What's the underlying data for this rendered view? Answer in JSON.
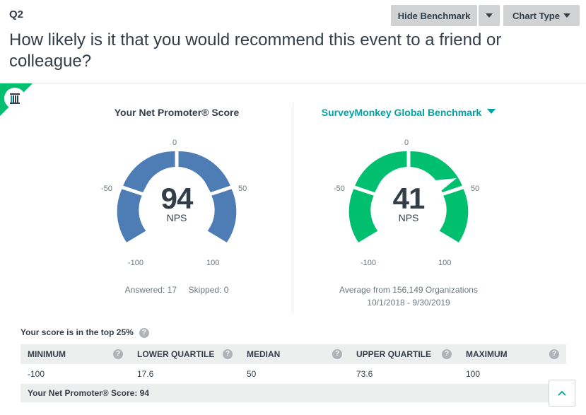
{
  "question": {
    "number": "Q2",
    "text": "How likely is it that you would recommend this event to a friend or colleague?"
  },
  "toolbar": {
    "hide_benchmark": "Hide Benchmark",
    "chart_type": "Chart Type"
  },
  "left_panel": {
    "title": "Your Net Promoter® Score",
    "score": "94",
    "unit": "NPS",
    "ticks": {
      "top": "0",
      "left": "-50",
      "right": "50",
      "bottom_left": "-100",
      "bottom_right": "100"
    },
    "answered": "Answered: 17",
    "skipped": "Skipped: 0",
    "color": "#4e7db5"
  },
  "right_panel": {
    "title": "SurveyMonkey Global Benchmark",
    "score": "41",
    "unit": "NPS",
    "ticks": {
      "top": "0",
      "left": "-50",
      "right": "50",
      "bottom_left": "-100",
      "bottom_right": "100"
    },
    "average": "Average from 156,149 Organizations",
    "date_range": "10/1/2018 - 9/30/2019",
    "color": "#00bf6f"
  },
  "summary": {
    "top_note": "Your score is in the top 25%",
    "headers": [
      "MINIMUM",
      "LOWER QUARTILE",
      "MEDIAN",
      "UPPER QUARTILE",
      "MAXIMUM"
    ],
    "values": [
      "-100",
      "17.6",
      "50",
      "73.6",
      "100"
    ],
    "footer": "Your Net Promoter® Score: 94"
  },
  "icons": {
    "help": "question-mark-icon",
    "scroll_top": "chevron-up-icon",
    "corner": "benchmark-building-icon"
  },
  "colors": {
    "accent_green": "#00bf6f",
    "benchmark_teal": "#00a3a3"
  }
}
